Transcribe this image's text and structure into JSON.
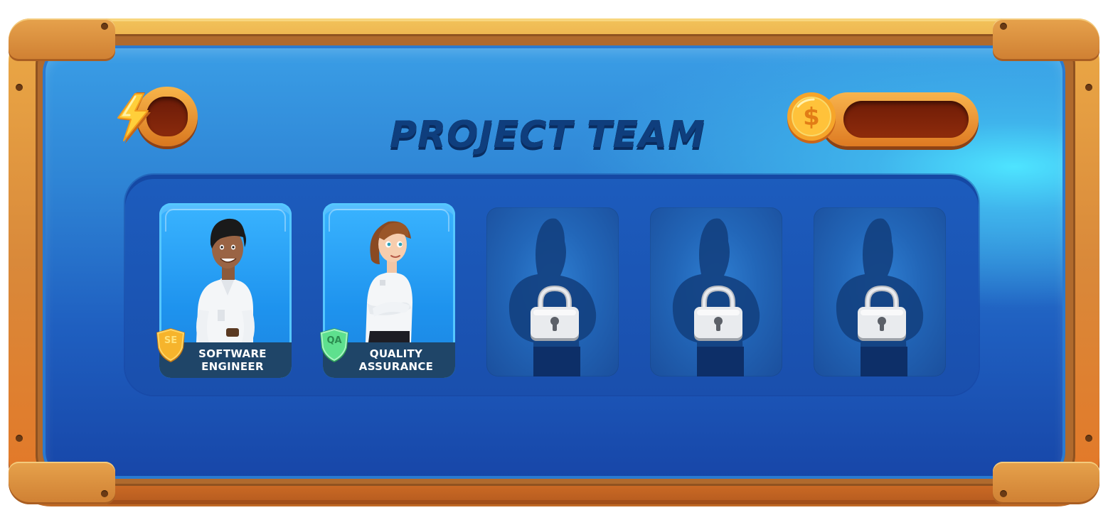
{
  "screen": {
    "title": "PROJECT TEAM"
  },
  "hud": {
    "energy": {
      "icon": "lightning-bolt-icon",
      "value": ""
    },
    "coins": {
      "icon": "dollar-coin-icon",
      "value": ""
    }
  },
  "team": {
    "members": [
      {
        "role_line1": "SOFTWARE",
        "role_line2": "ENGINEER",
        "badge": "SE",
        "badge_color": "#f4b72b",
        "locked": false
      },
      {
        "role_line1": "QUALITY",
        "role_line2": "ASSURANCE",
        "badge": "QA",
        "badge_color": "#5ee08e",
        "locked": false
      },
      {
        "locked": true,
        "icon": "padlock-icon"
      },
      {
        "locked": true,
        "icon": "padlock-icon"
      },
      {
        "locked": true,
        "icon": "padlock-icon"
      }
    ]
  },
  "colors": {
    "frame": "#e0913a",
    "screen": "#2f86d6",
    "title": "#0f3e7d",
    "label_bar": "#1f4568"
  }
}
